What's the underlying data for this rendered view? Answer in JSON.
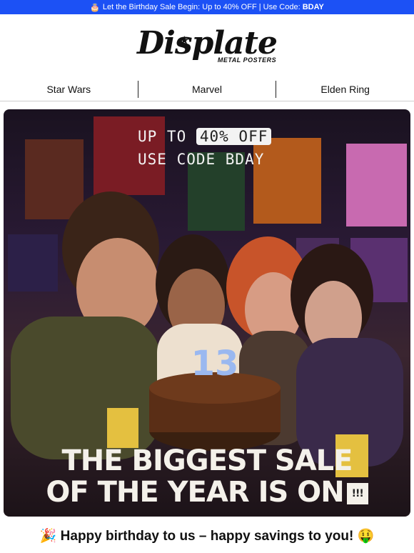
{
  "topbar": {
    "icon": "birthday-cake-icon",
    "text": "Let the Birthday Sale Begin: Up to 40% OFF | Use Code: ",
    "code": "BDAY"
  },
  "logo": {
    "brand": "Displate",
    "tagline": "METAL POSTERS"
  },
  "nav": {
    "items": [
      {
        "label": "Star Wars"
      },
      {
        "label": "Marvel"
      },
      {
        "label": "Elden Ring"
      }
    ]
  },
  "hero": {
    "promo_prefix": "UP TO ",
    "promo_highlight": "40% OFF",
    "promo_code_line": "USE CODE BDAY",
    "candle_number": "13",
    "headline_line1": "THE BIGGEST SALE",
    "headline_line2": "OF THE YEAR IS ON",
    "badge_text": "!!!"
  },
  "footer": {
    "text": "🎉 Happy birthday to us – happy savings to you! 🤑"
  },
  "colors": {
    "topbar": "#1c51f5",
    "headline": "#f4f1ea"
  }
}
